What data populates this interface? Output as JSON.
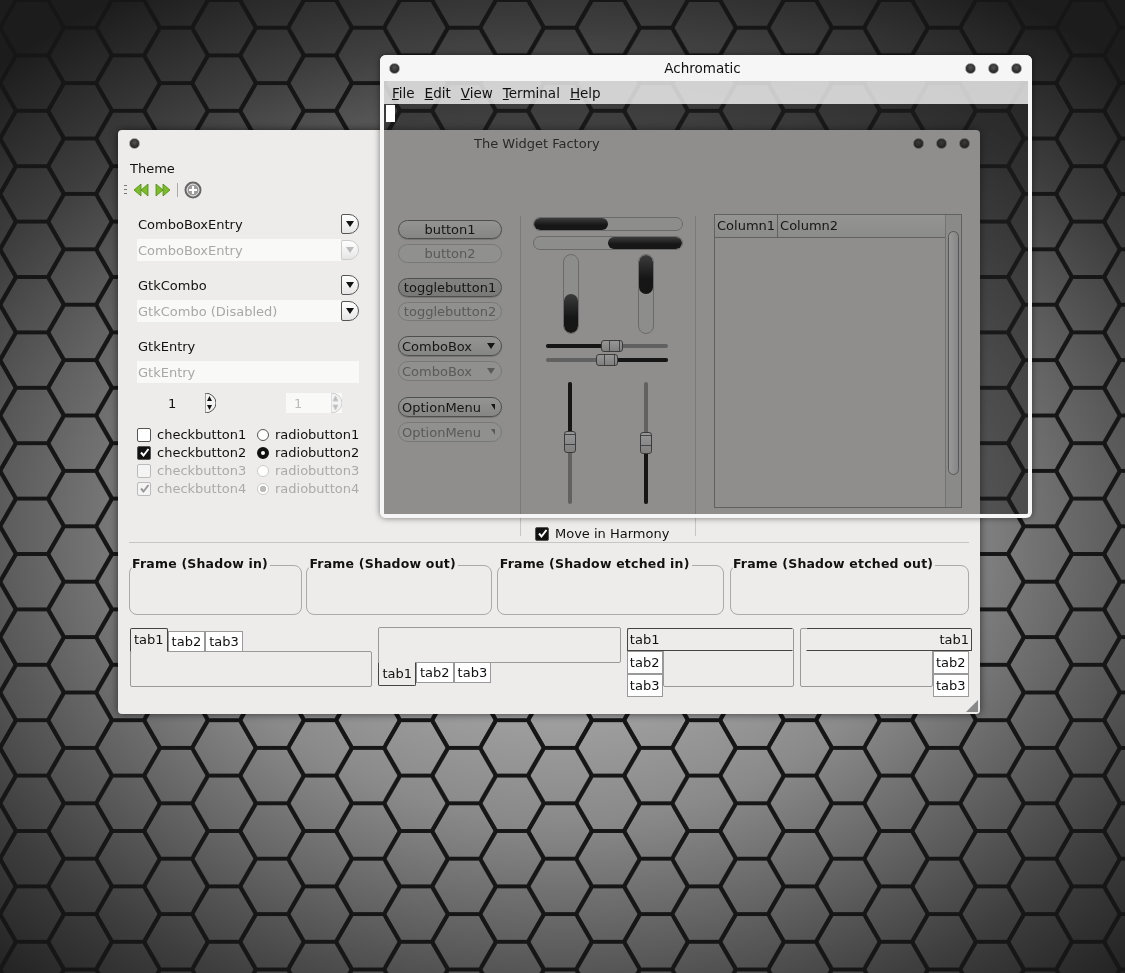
{
  "widget_factory": {
    "title": "The Widget Factory",
    "theme_label": "Theme",
    "fields": [
      {
        "kind": "combo_entry",
        "text": "ComboBoxEntry",
        "disabled": false
      },
      {
        "kind": "combo_entry",
        "text": "ComboBoxEntry",
        "disabled": true
      },
      {
        "kind": "combo",
        "text": "GtkCombo",
        "disabled": false
      },
      {
        "kind": "combo",
        "text": "GtkCombo (Disabled)",
        "disabled": true
      },
      {
        "kind": "entry",
        "text": "GtkEntry",
        "disabled": false
      },
      {
        "kind": "entry",
        "text": "GtkEntry",
        "disabled": true
      }
    ],
    "spins": [
      {
        "value": "1",
        "disabled": false
      },
      {
        "value": "1",
        "disabled": true
      }
    ],
    "checks": [
      {
        "label": "checkbutton1",
        "checked": false,
        "disabled": false
      },
      {
        "label": "checkbutton2",
        "checked": true,
        "disabled": false
      },
      {
        "label": "checkbutton3",
        "checked": false,
        "disabled": true
      },
      {
        "label": "checkbutton4",
        "checked": true,
        "disabled": true
      }
    ],
    "radios": [
      {
        "label": "radiobutton1",
        "selected": false,
        "disabled": false
      },
      {
        "label": "radiobutton2",
        "selected": true,
        "disabled": false
      },
      {
        "label": "radiobutton3",
        "selected": false,
        "disabled": true
      },
      {
        "label": "radiobutton4",
        "selected": true,
        "disabled": true
      }
    ],
    "buttons": [
      {
        "kind": "button",
        "label": "button1",
        "disabled": false
      },
      {
        "kind": "button",
        "label": "button2",
        "disabled": true
      },
      {
        "kind": "toggle",
        "label": "togglebutton1",
        "disabled": false,
        "on": true
      },
      {
        "kind": "toggle",
        "label": "togglebutton2",
        "disabled": true,
        "on": false
      },
      {
        "kind": "combo",
        "label": "ComboBox",
        "disabled": false
      },
      {
        "kind": "combo",
        "label": "ComboBox",
        "disabled": true
      },
      {
        "kind": "combo",
        "label": "OptionMenu",
        "disabled": false
      },
      {
        "kind": "combo",
        "label": "OptionMenu",
        "disabled": true
      }
    ],
    "progress": {
      "horizontal": [
        {
          "inverted": false,
          "level": 0.5
        },
        {
          "inverted": true,
          "level": 0.5
        }
      ],
      "vertical": [
        {
          "inverted": false,
          "level": 0.5
        },
        {
          "inverted": true,
          "level": 0.5
        }
      ]
    },
    "scales": {
      "horizontal": [
        {
          "inverted": false,
          "level": 0.54
        },
        {
          "inverted": true,
          "level": 0.5
        }
      ],
      "vertical": [
        {
          "inverted": true,
          "level": 0.49
        },
        {
          "inverted": false,
          "level": 0.5
        }
      ]
    },
    "harmony": {
      "label": "Move in Harmony",
      "checked": true
    },
    "tree": {
      "columns": [
        "Column1",
        "Column2"
      ]
    },
    "frames": [
      "Frame (Shadow in)",
      "Frame (Shadow out)",
      "Frame (Shadow etched in)",
      "Frame (Shadow etched out)"
    ],
    "notebooks": [
      {
        "kind": "top",
        "tabs": [
          {
            "label": "tab1",
            "selected": true
          },
          {
            "label": "tab2",
            "selected": false
          },
          {
            "label": "tab3",
            "selected": false
          }
        ]
      },
      {
        "kind": "bottom",
        "tabs": [
          {
            "label": "tab1",
            "selected": true
          },
          {
            "label": "tab2",
            "selected": false
          },
          {
            "label": "tab3",
            "selected": false
          }
        ]
      },
      {
        "kind": "left",
        "tabs": [
          {
            "label": "tab1",
            "selected": true
          },
          {
            "label": "tab2",
            "selected": false
          },
          {
            "label": "tab3",
            "selected": false
          }
        ]
      },
      {
        "kind": "right",
        "tabs": [
          {
            "label": "tab1",
            "selected": true
          },
          {
            "label": "tab2",
            "selected": false
          },
          {
            "label": "tab3",
            "selected": false
          }
        ]
      }
    ]
  },
  "terminal": {
    "title": "Achromatic",
    "menu": [
      {
        "label": "File"
      },
      {
        "label": "Edit"
      },
      {
        "label": "View"
      },
      {
        "label": "Terminal"
      },
      {
        "label": "Help"
      }
    ]
  }
}
